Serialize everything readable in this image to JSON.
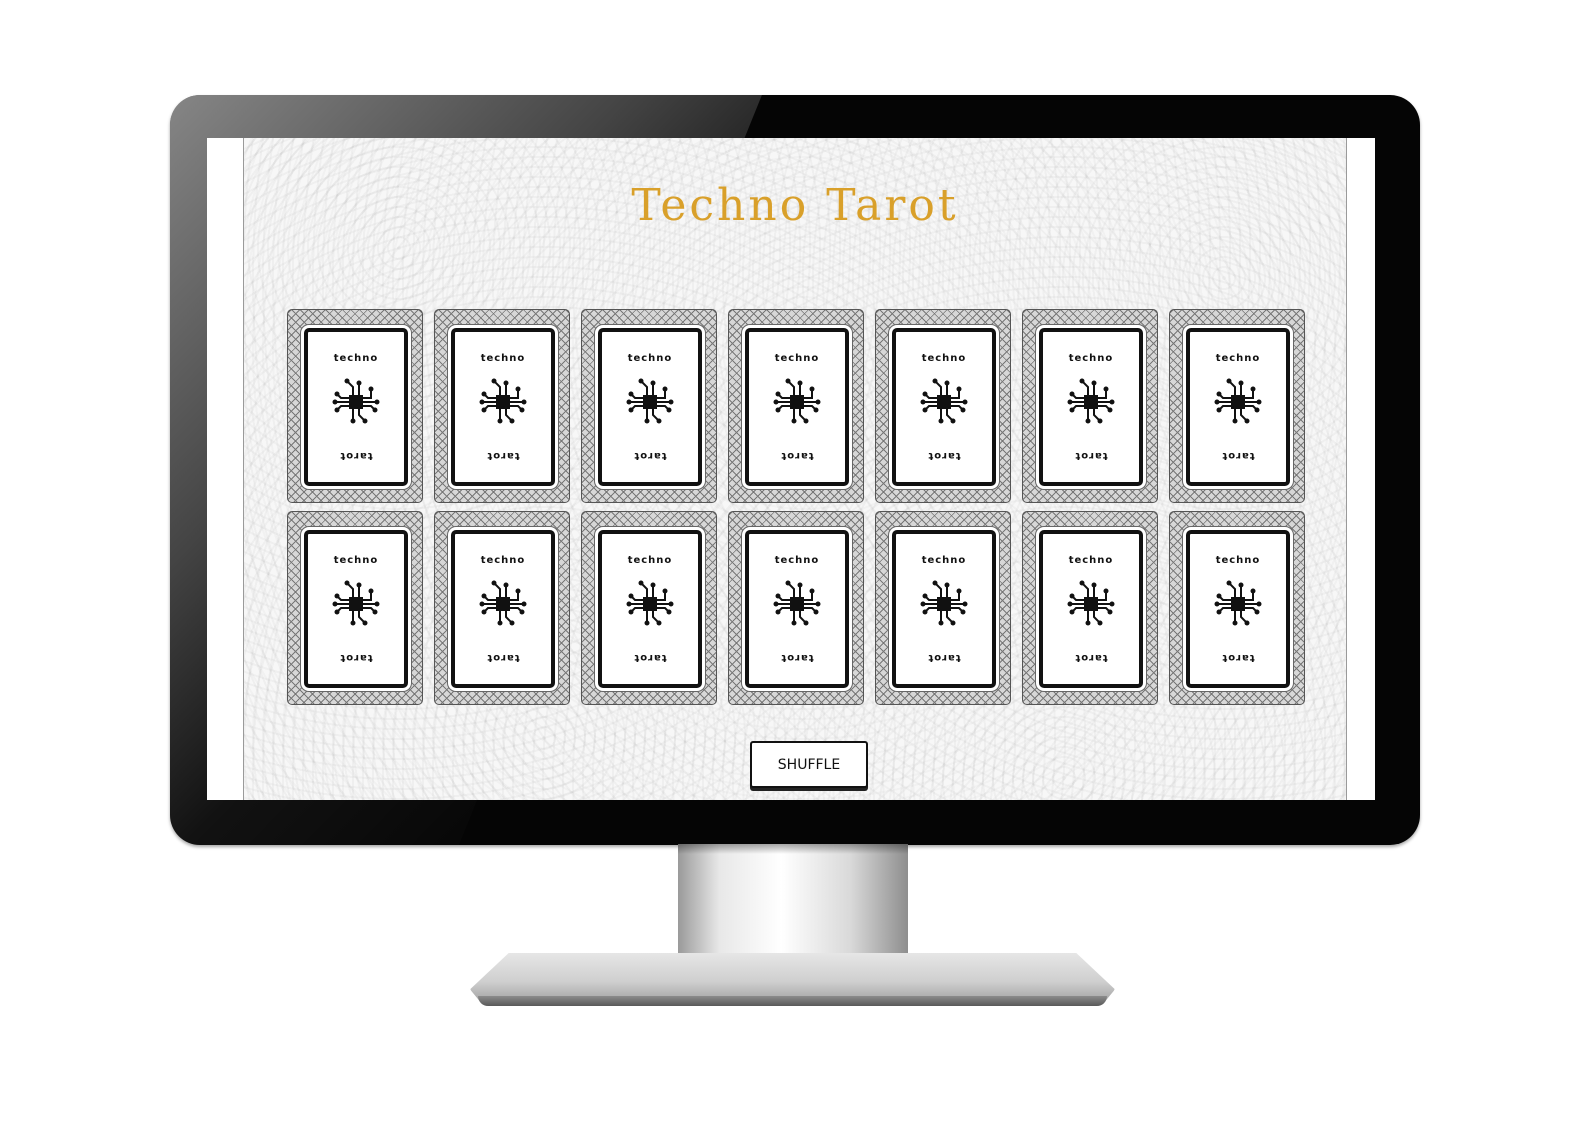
{
  "app": {
    "title": "Techno Tarot"
  },
  "cards": [
    {
      "top_label": "techno",
      "bottom_label": "tarot",
      "icon": "circuit-chip-icon"
    },
    {
      "top_label": "techno",
      "bottom_label": "tarot",
      "icon": "circuit-chip-icon"
    },
    {
      "top_label": "techno",
      "bottom_label": "tarot",
      "icon": "circuit-chip-icon"
    },
    {
      "top_label": "techno",
      "bottom_label": "tarot",
      "icon": "circuit-chip-icon"
    },
    {
      "top_label": "techno",
      "bottom_label": "tarot",
      "icon": "circuit-chip-icon"
    },
    {
      "top_label": "techno",
      "bottom_label": "tarot",
      "icon": "circuit-chip-icon"
    },
    {
      "top_label": "techno",
      "bottom_label": "tarot",
      "icon": "circuit-chip-icon"
    },
    {
      "top_label": "techno",
      "bottom_label": "tarot",
      "icon": "circuit-chip-icon"
    },
    {
      "top_label": "techno",
      "bottom_label": "tarot",
      "icon": "circuit-chip-icon"
    },
    {
      "top_label": "techno",
      "bottom_label": "tarot",
      "icon": "circuit-chip-icon"
    },
    {
      "top_label": "techno",
      "bottom_label": "tarot",
      "icon": "circuit-chip-icon"
    },
    {
      "top_label": "techno",
      "bottom_label": "tarot",
      "icon": "circuit-chip-icon"
    },
    {
      "top_label": "techno",
      "bottom_label": "tarot",
      "icon": "circuit-chip-icon"
    },
    {
      "top_label": "techno",
      "bottom_label": "tarot",
      "icon": "circuit-chip-icon"
    }
  ],
  "controls": {
    "shuffle_label": "SHUFFLE"
  },
  "colors": {
    "title": "#d9a02a",
    "card_border": "#111111",
    "background": "#f7f7f7"
  }
}
